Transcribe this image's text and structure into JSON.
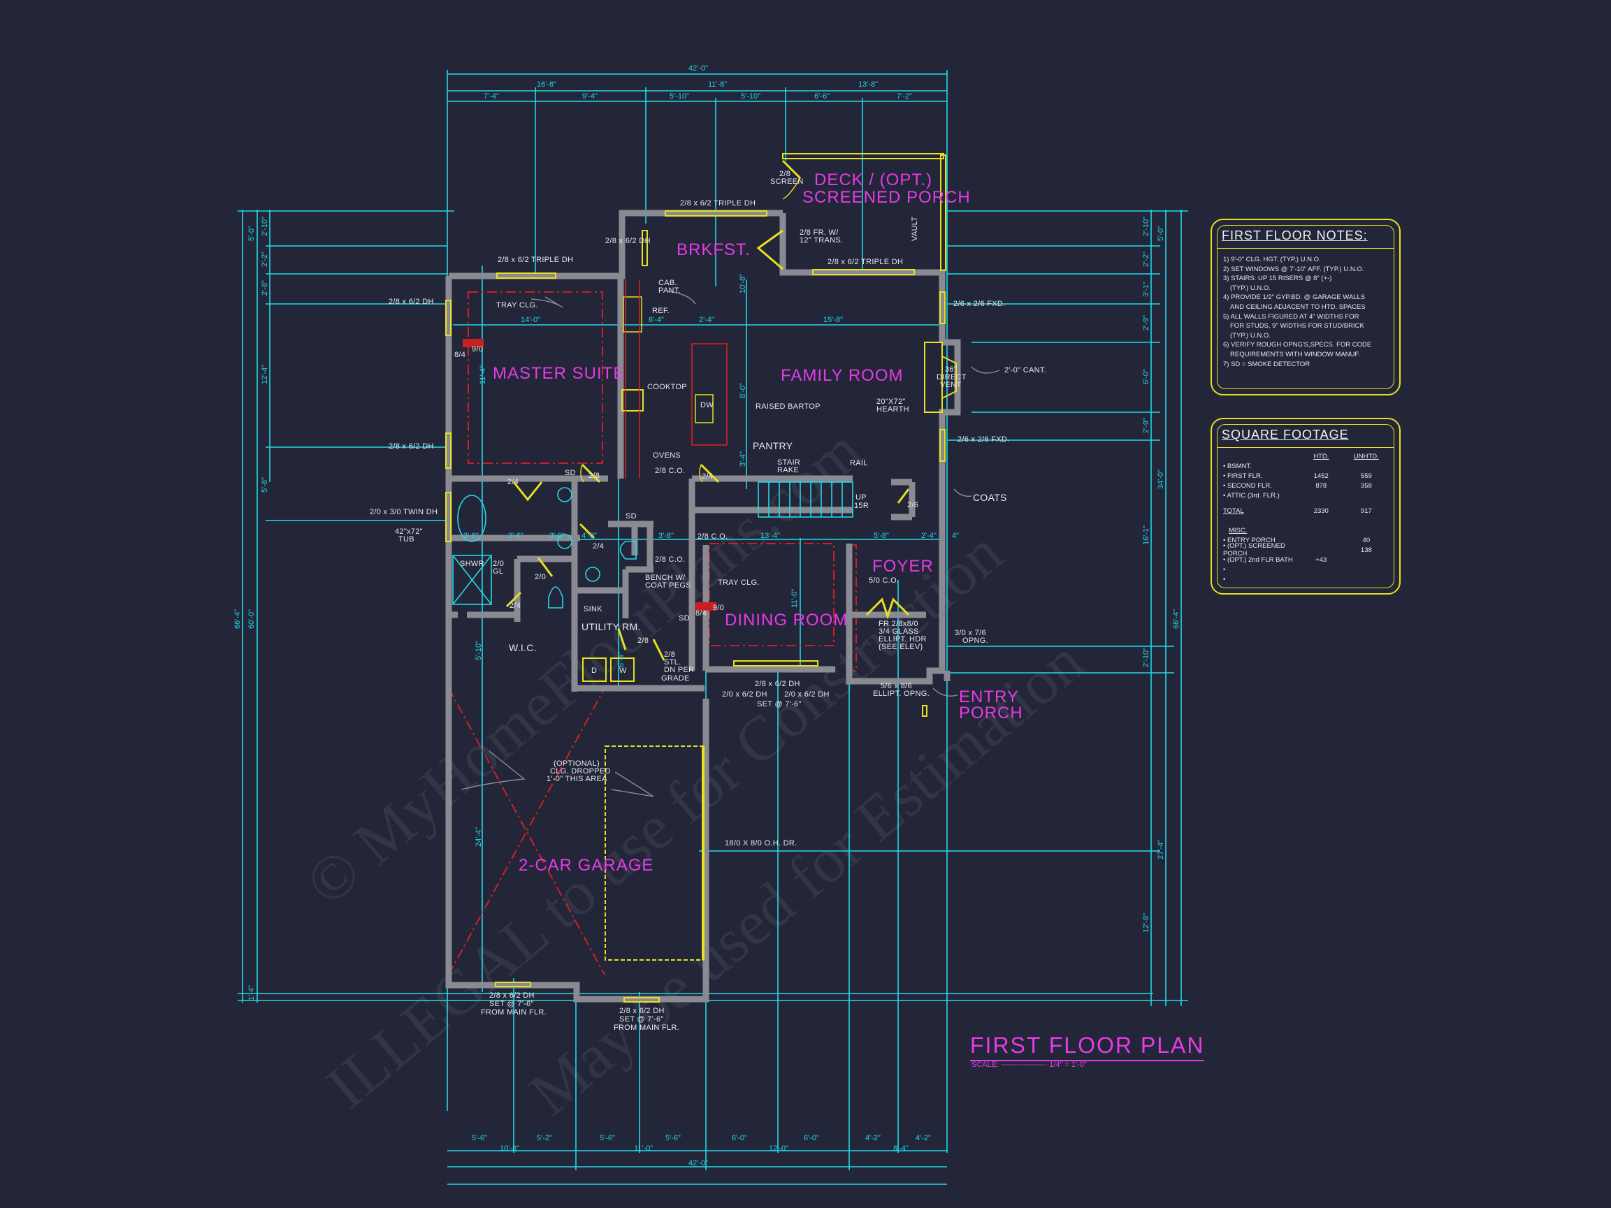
{
  "drawing": {
    "title": "FIRST FLOOR PLAN",
    "scale_label": "SCALE:",
    "scale_value": "1/4\" = 1'-0\"",
    "watermark_lines": [
      "© MyHomeFloorPlans.com",
      "ILLEGAL to use for Construction",
      "May be used for Estimation"
    ]
  },
  "rooms": {
    "master_suite": "MASTER SUITE",
    "brkfst": "BRKFST.",
    "deck_line1": "DECK / (OPT.)",
    "deck_line2": "SCREENED PORCH",
    "family_room": "FAMILY ROOM",
    "dining_room": "DINING ROOM",
    "foyer": "FOYER",
    "entry_porch_line1": "ENTRY",
    "entry_porch_line2": "PORCH",
    "garage": "2-CAR GARAGE",
    "utility": "UTILITY RM.",
    "wic": "W.I.C.",
    "pantry": "PANTRY",
    "coats": "COATS"
  },
  "labels": {
    "tray_clg": "TRAY CLG.",
    "tray_clg_dining": "TRAY CLG.",
    "cab_pant_1": "CAB.",
    "cab_pant_2": "PANT.",
    "ref": "REF.",
    "cooktop": "COOKTOP",
    "dw": "DW",
    "ovens": "OVENS",
    "raised_bartop": "RAISED BARTOP",
    "stair_rake_1": "STAIR",
    "stair_rake_2": "RAKE",
    "rail": "RAIL",
    "up_1": "UP",
    "up_2": "15R",
    "hearth_1": "20\"X72\"",
    "hearth_2": "HEARTH",
    "vent_1": "36\"",
    "vent_2": "DIRECT",
    "vent_3": "VENT",
    "cant": "2'-0\" CANT.",
    "vault": "VAULT",
    "screen_1": "2/8",
    "screen_2": "SCREEN",
    "fr_trans_1": "2/8 FR. W/",
    "fr_trans_2": "12\" TRANS.",
    "tub_1": "42\"x72\"",
    "tub_2": "TUB",
    "shwr": "SHWR",
    "shwr_gl_1": "2/0",
    "shwr_gl_2": "GL",
    "bench_1": "BENCH W/",
    "bench_2": "COAT PEGS",
    "sink": "SINK",
    "dryer": "D",
    "washer": "W",
    "stl_1": "2/8",
    "stl_2": "STL.",
    "dn_grade_1": "DN PER",
    "dn_grade_2": "GRADE",
    "sd": "SD",
    "co_kitchen": "2/8  C.O.",
    "co_hall": "2/8  C.O.",
    "co_dining": "2/8  C.O.",
    "co_foyer": "5/0  C.O.",
    "foyer_door_1": "FR 2/8x8/0",
    "foyer_door_2": "3/4 GLASS",
    "foyer_door_3": "ELLIPT. HDR",
    "foyer_door_4": "(SEE ELEV)",
    "ellipt_1": "5/6 x 8/6",
    "ellipt_2": "ELLIPT. OPNG.",
    "opng_1": "3/0 x 7/6",
    "opng_2": "OPNG.",
    "garage_note_1": "(OPTIONAL)",
    "garage_note_2": "CLG. DROPPED",
    "garage_note_3": "1'-0\" THIS AREA",
    "oh_door": "18/0 X 8/0 O.H. DR.",
    "d_24a": "2/4",
    "d_24b": "2/4",
    "d_24c": "2/4",
    "d_24d": "2/4",
    "d_28a": "2/8",
    "d_28b": "2/8",
    "d_20": "2/0",
    "d_26": "2/6",
    "d_84a": "8/4",
    "d_90a": "9/0",
    "d_84b": "8/4",
    "d_90b": "9/0"
  },
  "windows": {
    "w1": "2/8 x 6/2 TRIPLE DH",
    "w2": "2/8 x 6/2 TRIPLE DH",
    "w3": "2/8 x 6/2 TRIPLE DH",
    "w4": "2/8 x 6/2 DH",
    "w5": "2/8 x 6/2 DH",
    "w6": "2/8 x 6/2 DH",
    "w7": "2/0 x 3/0 TWIN DH",
    "w8": "2/6 x 2/6 FXD.",
    "w9": "2/6 x 2/6 FXD.",
    "dining_1": "2/8 x 6/2 DH",
    "dining_2": "2/0 x 6/2 DH",
    "dining_3": "2/0 x 6/2 DH",
    "dining_4": "SET @ 7'-6\"",
    "garage_w1_1": "2/8 x 6/2 DH",
    "garage_w1_2": "SET @ 7'-6\"",
    "garage_w1_3": "FROM MAIN FLR.",
    "garage_w2_1": "2/8 x 6/2 DH",
    "garage_w2_2": "SET @ 7'-6\"",
    "garage_w2_3": "FROM MAIN FLR."
  },
  "dimensions": {
    "top_overall": "42'-0\"",
    "top_mid": [
      "16'-8\"",
      "11'-8\"",
      "13'-8\""
    ],
    "top_detail": [
      "7'-4\"",
      "9'-4\"",
      "5'-10\"",
      "5'-10\"",
      "6'-6\"",
      "7'-2\""
    ],
    "bottom_detail": [
      "5'-6\"",
      "5'-2\"",
      "5'-6\"",
      "5'-6\"",
      "6'-0\"",
      "6'-0\"",
      "4'-2\"",
      "4'-2\""
    ],
    "bottom_mid": [
      "10'-8\"",
      "11'-0\"",
      "12'-0\"",
      "8'-4\""
    ],
    "bottom_overall": "42'-0\"",
    "left_overall": "66'-4\"",
    "left_mid": [
      "5'-0\"",
      "60'-0\"",
      "1'-4\""
    ],
    "left_detail": [
      "2'-10\"",
      "2'-2\"",
      "2'-8\"",
      "12'-4\"",
      "5'-8\""
    ],
    "right_overall": "66'-4\"",
    "right_mid": [
      "5'-0\"",
      "34'-0\"",
      "27'-4\""
    ],
    "right_detail": [
      "2'-10\"",
      "2'-2\"",
      "3'-1\"",
      "2'-9\"",
      "6'-0\"",
      "2'-9\"",
      "16'-1\"",
      "2'-10\"",
      "12'-8\""
    ],
    "interior": {
      "master_w": "14'-0\"",
      "master_h": "11'-4\"",
      "kitchen_w": "6'-4\"",
      "island_w": "2'-4\"",
      "family_w": "15'-8\"",
      "family_h": "8'-0\"",
      "brk_h": "10'-8\"",
      "pantry_h": "3'-4\"",
      "bath_a": "3'-8\"",
      "bath_b": "3'-6\"",
      "bath_c": "3'-0\"",
      "hall_a": "4'-0\"",
      "hall_b": "3'-8\"",
      "dining_w": "13'-4\"",
      "dining_h": "11'-0\"",
      "foyer_w": "5'-8\"",
      "coat_w": "2'-4\"",
      "wall": "4\"",
      "garage_h": "24'-4\"",
      "wic_h": "5'-10\"",
      "util_h": "6'-4\""
    }
  },
  "notes_panel": {
    "title": "FIRST FLOOR NOTES:",
    "items": [
      "1) 9'-0\" CLG. HGT. (TYP.) U.N.O.",
      "2) SET WINDOWS @ 7'-10\" AFF. (TYP.) U.N.O.",
      "3) STAIRS: UP 15 RISERS @ 8\" (+-)",
      "   (TYP.) U.N.O.",
      "4) PROVIDE 1/2\" GYP.BD. @ GARAGE WALLS",
      "   AND CEILING ADJACENT TO HTD. SPACES",
      "5) ALL WALLS FIGURED AT 4\" WIDTHS FOR",
      "   FOR STUDS, 9\" WIDTHS FOR STUD/BRICK",
      "   (TYP.) U.N.O.",
      "6) VERIFY ROUGH OPNG'S,SPECS. FOR CODE",
      "   REQUIREMENTS WITH WINDOW MANUF.",
      "7) SD = SMOKE DETECTOR"
    ]
  },
  "sqft_panel": {
    "title": "SQUARE FOOTAGE",
    "col_htd": "HTD.",
    "col_unhtd": "UNHTD.",
    "rows": [
      {
        "label": "• BSMNT.",
        "htd": "",
        "unhtd": ""
      },
      {
        "label": "• FIRST FLR.",
        "htd": "1452",
        "unhtd": "559"
      },
      {
        "label": "• SECOND FLR.",
        "htd": "878",
        "unhtd": "358"
      },
      {
        "label": "• ATTIC (3rd. FLR.)",
        "htd": "",
        "unhtd": ""
      }
    ],
    "total": {
      "label": "TOTAL",
      "htd": "2330",
      "unhtd": "917"
    },
    "misc_title": "MISC.",
    "misc_rows": [
      {
        "label": "• ENTRY PORCH",
        "htd": "",
        "unhtd": "40"
      },
      {
        "label": "• (OPT.) SCREENED PORCH",
        "htd": "",
        "unhtd": "138"
      },
      {
        "label": "• (OPT.) 2nd FLR BATH",
        "htd": "+43",
        "unhtd": ""
      },
      {
        "label": "•",
        "htd": "",
        "unhtd": ""
      },
      {
        "label": "•",
        "htd": "",
        "unhtd": ""
      }
    ]
  }
}
